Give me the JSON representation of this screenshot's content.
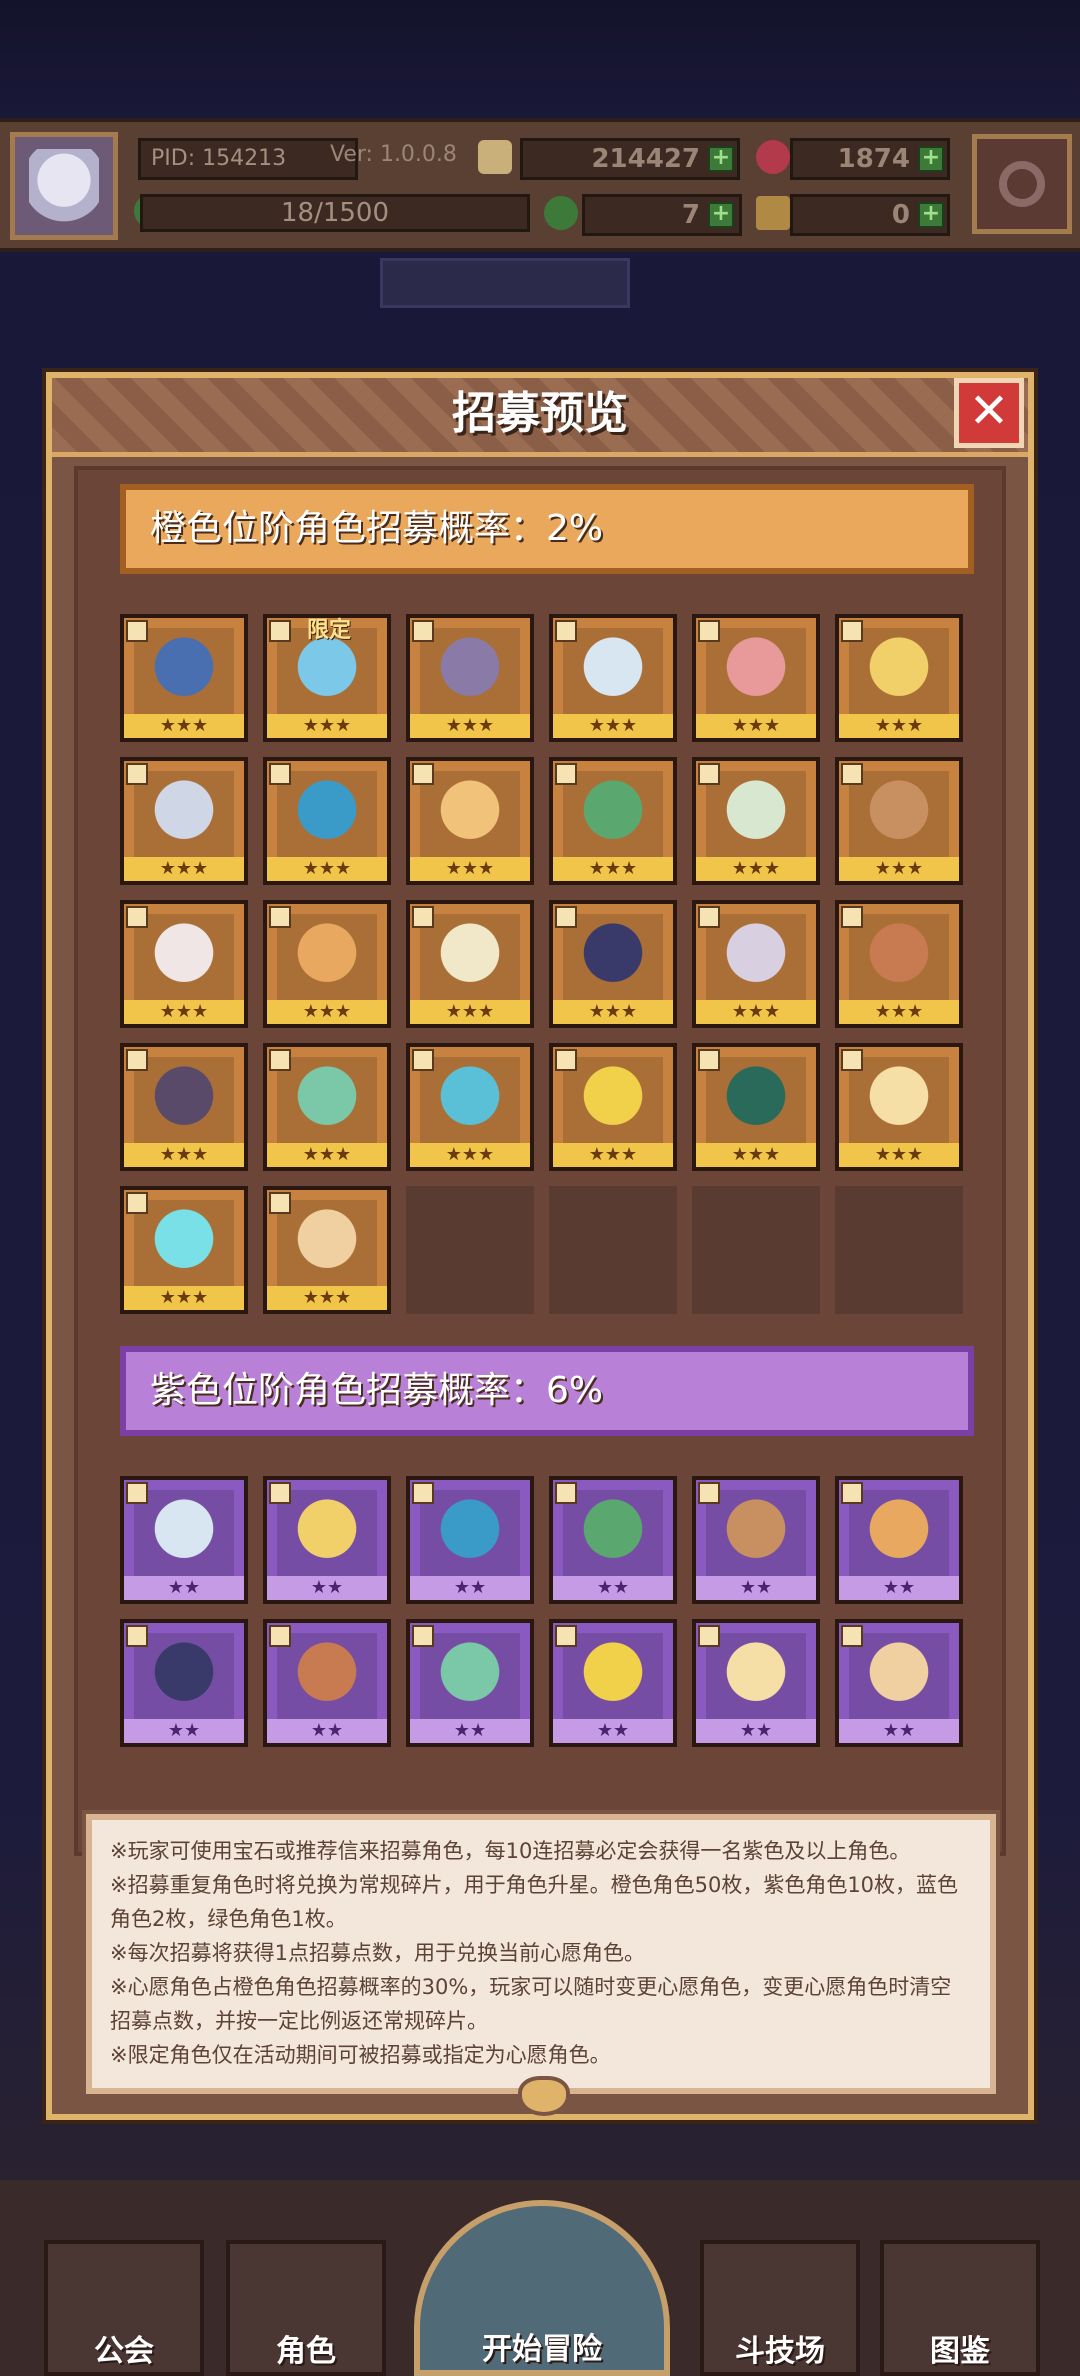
{
  "header": {
    "pid": "PID: 154213",
    "version": "Ver: 1.0.0.8",
    "gold": "214427",
    "gems": "1874",
    "xp": "18/1500",
    "clover": "7",
    "keys": "0"
  },
  "modal": {
    "title": "招募预览",
    "close_icon": "close-icon",
    "orange_rate": "橙色位阶角色招募概率：2%",
    "purple_rate": "紫色位阶角色招募概率：6%",
    "limited_label": "限定",
    "stars3": "★★★",
    "stars2": "★★",
    "info": [
      "※玩家可使用宝石或推荐信来招募角色，每10连招募必定会获得一名紫色及以上角色。",
      "※招募重复角色时将兑换为常规碎片，用于角色升星。橙色角色50枚，紫色角色10枚，蓝色角色2枚，绿色角色1枚。",
      "※每次招募将获得1点招募点数，用于兑换当前心愿角色。",
      "※心愿角色占橙色角色招募概率的30%，玩家可以随时变更心愿角色，变更心愿角色时清空招募点数，并按一定比例返还常规碎片。",
      "※限定角色仅在活动期间可被招募或指定为心愿角色。"
    ]
  },
  "nav": {
    "guild": "公会",
    "roles": "角色",
    "adventure": "开始冒险",
    "arena": "斗技场",
    "codex": "图鉴"
  },
  "colors": {
    "orange_tier": "#c88240",
    "purple_tier": "#8b5ac0",
    "modal_border": "#e0b36a"
  }
}
